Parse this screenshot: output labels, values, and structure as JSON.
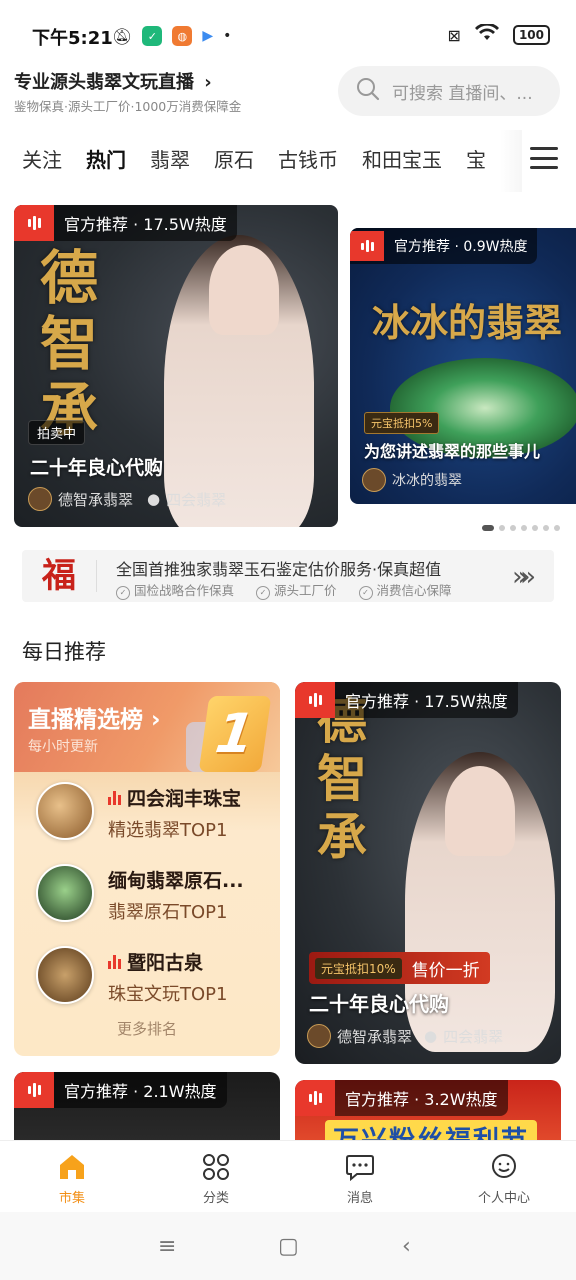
{
  "status_bar": {
    "time": "下午5:21",
    "battery": "100",
    "dot": "•"
  },
  "header": {
    "title": "专业源头翡翠文玩直播",
    "title_chevron": "›",
    "subtitle": "鉴物保真·源头工厂价·1000万消费保障金",
    "search_placeholder": "可搜索 直播间、..."
  },
  "tabs": [
    {
      "label": "关注",
      "active": false
    },
    {
      "label": "热门",
      "active": true
    },
    {
      "label": "翡翠",
      "active": false
    },
    {
      "label": "原石",
      "active": false
    },
    {
      "label": "古钱币",
      "active": false
    },
    {
      "label": "和田宝玉",
      "active": false
    },
    {
      "label": "宝",
      "active": false
    }
  ],
  "hero": [
    {
      "tag": "官方推荐 · 17.5W热度",
      "calligraphy": [
        "德",
        "智",
        "承"
      ],
      "badge": "拍卖中",
      "title": "二十年良心代购",
      "host": "德智承翡翠",
      "location": "四会翡翠"
    },
    {
      "tag": "官方推荐 · 0.9W热度",
      "calligraphy": "冰冰的翡翠",
      "coupon": "元宝抵扣5%",
      "title": "为您讲述翡翠的那些事儿",
      "host": "冰冰的翡翠"
    }
  ],
  "carousel": {
    "count": 7,
    "active_index": 0
  },
  "banner": {
    "logo": "福",
    "title": "全国首推独家翡翠玉石鉴定估价服务·保真超值",
    "tags": [
      "国检战略合作保真",
      "源头工厂价",
      "消费信心保障"
    ],
    "arrow": "»»"
  },
  "daily": {
    "section_title": "每日推荐",
    "ranking": {
      "title": "直播精选榜",
      "title_chevron": "›",
      "subtitle": "每小时更新",
      "number": "1",
      "items": [
        {
          "name": "四会润丰珠宝",
          "desc": "精选翡翠TOP1",
          "live": true,
          "avatar_color": "#b97a3a"
        },
        {
          "name": "缅甸翡翠原石...",
          "desc": "翡翠原石TOP1",
          "live": false,
          "avatar_color": "#2f4b2a"
        },
        {
          "name": "暨阳古泉",
          "desc": "珠宝文玩TOP1",
          "live": true,
          "avatar_color": "#8c6a4a"
        }
      ],
      "more": "更多排名"
    },
    "live_card": {
      "tag": "官方推荐 · 17.5W热度",
      "calligraphy": [
        "德",
        "智",
        "承"
      ],
      "coupon": "元宝抵扣10%",
      "promo": "售价一折",
      "title": "二十年良心代购",
      "host": "德智承翡翠",
      "location": "四会翡翠"
    },
    "peek_cards": [
      {
        "tag": "官方推荐 · 2.1W热度"
      },
      {
        "tag": "官方推荐 · 3.2W热度",
        "banner_text": "万兴粉丝福利节"
      }
    ]
  },
  "bottom_nav": [
    {
      "label": "市集",
      "icon": "market-icon",
      "active": true
    },
    {
      "label": "分类",
      "icon": "category-icon",
      "active": false
    },
    {
      "label": "消息",
      "icon": "message-icon",
      "active": false
    },
    {
      "label": "个人中心",
      "icon": "profile-icon",
      "active": false
    }
  ],
  "colors": {
    "accent": "#f29018",
    "live_red": "#e8382c",
    "gold": "#d7a84a"
  }
}
